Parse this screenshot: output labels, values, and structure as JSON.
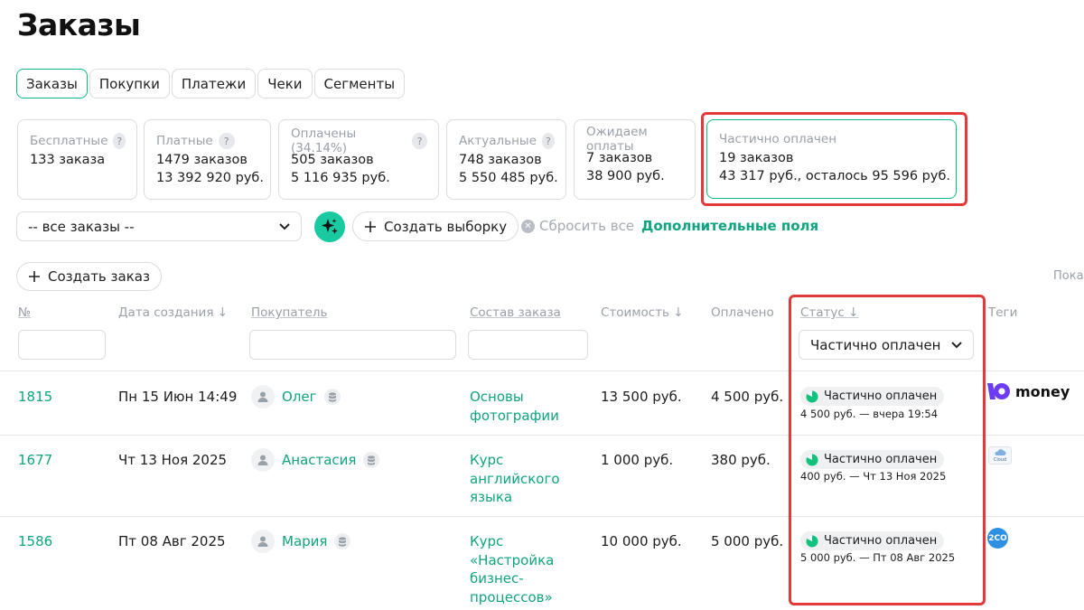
{
  "page": {
    "title": "Заказы"
  },
  "tabs": [
    {
      "label": "Заказы",
      "active": true
    },
    {
      "label": "Покупки",
      "active": false
    },
    {
      "label": "Платежи",
      "active": false
    },
    {
      "label": "Чеки",
      "active": false
    },
    {
      "label": "Сегменты",
      "active": false
    }
  ],
  "stats": {
    "free": {
      "label": "Бесплатные",
      "line1": "133 заказа"
    },
    "paid": {
      "label": "Платные",
      "line1": "1479 заказов",
      "line2": "13 392 920 руб."
    },
    "paid_done": {
      "label": "Оплачены (34.14%)",
      "line1": "505 заказов",
      "line2": "5 116 935 руб."
    },
    "actual": {
      "label": "Актуальные",
      "line1": "748 заказов",
      "line2": "5 550 485 руб."
    },
    "awaiting": {
      "label": "Ожидаем оплаты",
      "line1": "7 заказов",
      "line2": "38 900 руб."
    },
    "partial": {
      "label": "Частично оплачен",
      "line1": "19 заказов",
      "line2": "43 317 руб., осталось 95 596 руб."
    }
  },
  "toolbar": {
    "filter_value": "-- все заказы --",
    "create_selection": "Создать выборку",
    "reset_all": "Сбросить все",
    "extra_fields": "Дополнительные поля",
    "create_order": "Создать заказ",
    "show_label": "Пока"
  },
  "columns": {
    "number": "№",
    "created": "Дата создания ↓",
    "buyer": "Покупатель",
    "items": "Состав заказа",
    "cost": "Стоимость ↓",
    "paid": "Оплачено",
    "status": "Статус ↓",
    "tags": "Теги",
    "status_filter_value": "Частично оплачен"
  },
  "orders": [
    {
      "id": "1815",
      "date": "Пн 15 Июн 14:49",
      "buyer": "Олег",
      "items_lines": [
        "Основы",
        "фотографии"
      ],
      "cost": "13 500 руб.",
      "paid": "4 500 руб.",
      "status": "Частично оплачен",
      "status_note": "4 500 руб. — вчера 19:54",
      "tag": "money"
    },
    {
      "id": "1677",
      "date": "Чт 13 Ноя 2025",
      "buyer": "Анастасия",
      "items_lines": [
        "Курс",
        "английского",
        "языка"
      ],
      "cost": "1 000 руб.",
      "paid": "380 руб.",
      "status": "Частично оплачен",
      "status_note": "400 руб. — Чт 13 Ноя 2025",
      "tag": "Cloud"
    },
    {
      "id": "1586",
      "date": "Пт 08 Авг 2025",
      "buyer": "Мария",
      "items_lines": [
        "Курс",
        "«Настройка",
        "бизнес-",
        "процессов»"
      ],
      "cost": "10 000 руб.",
      "paid": "5 000 руб.",
      "status": "Частично оплачен",
      "status_note": "5 000 руб. — Пт 08 Авг 2025",
      "tag": "2CO"
    }
  ],
  "colors": {
    "accent": "#10a37f",
    "highlight": "#e03a3a",
    "border": "#d9dce1"
  }
}
